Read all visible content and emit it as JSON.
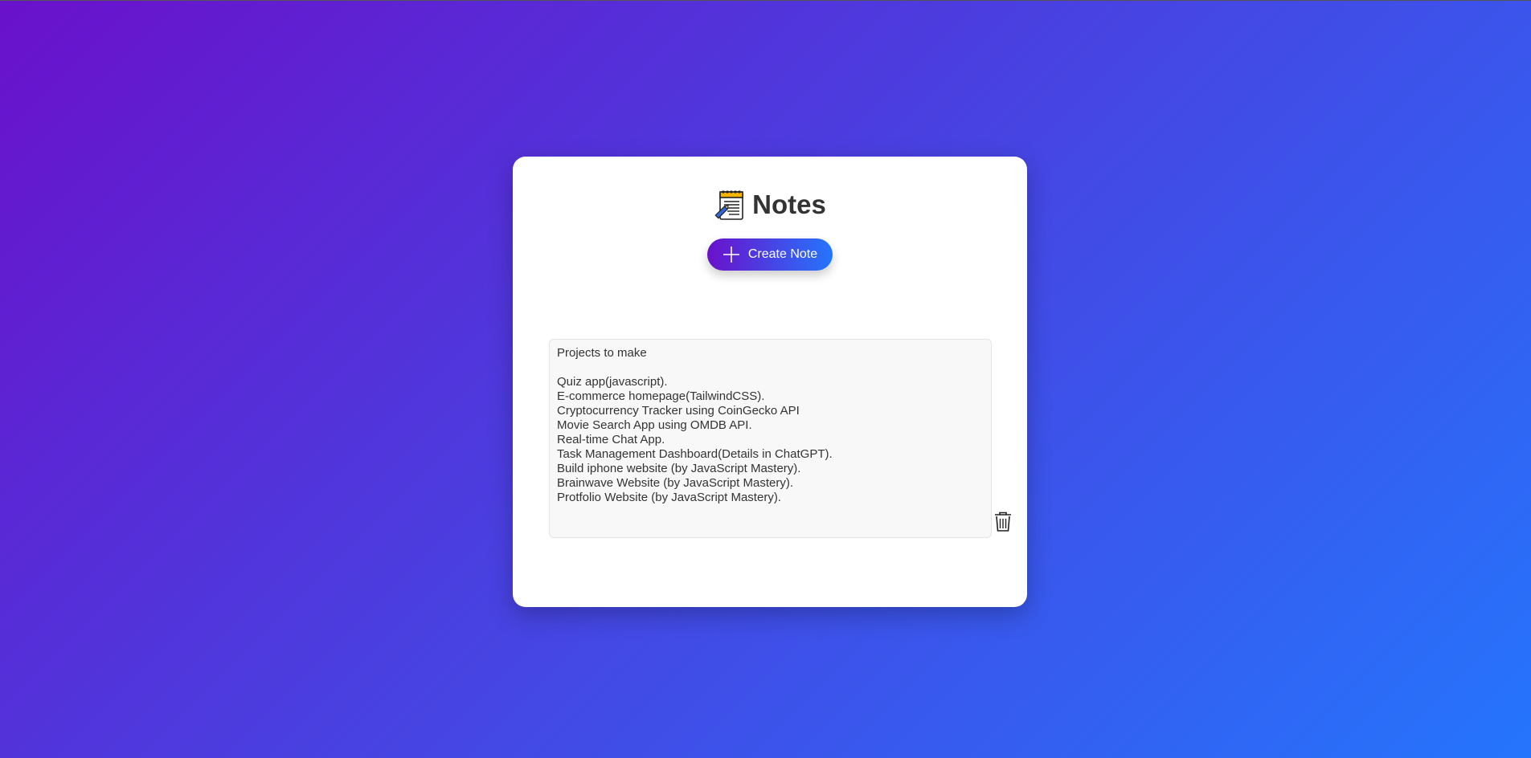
{
  "app": {
    "title": "Notes",
    "logo_icon": "notepad-icon"
  },
  "toolbar": {
    "create_label": "Create Note",
    "create_icon": "plus-icon"
  },
  "notes": [
    {
      "lines": [
        "Projects to make",
        "",
        "Quiz app(javascript).",
        "E-commerce homepage(TailwindCSS).",
        "Cryptocurrency Tracker using CoinGecko API",
        "Movie Search App using OMDB API.",
        "Real-time Chat App.",
        "Task Management Dashboard(Details in ChatGPT).",
        "Build iphone website (by JavaScript Mastery).",
        "Brainwave Website (by JavaScript Mastery).",
        "Protfolio Website (by JavaScript Mastery)."
      ],
      "delete_icon": "trash-icon"
    }
  ],
  "colors": {
    "gradient_start": "#6a11cb",
    "gradient_end": "#2575fc",
    "title_text": "#333333",
    "note_bg": "#f8f8f8"
  }
}
